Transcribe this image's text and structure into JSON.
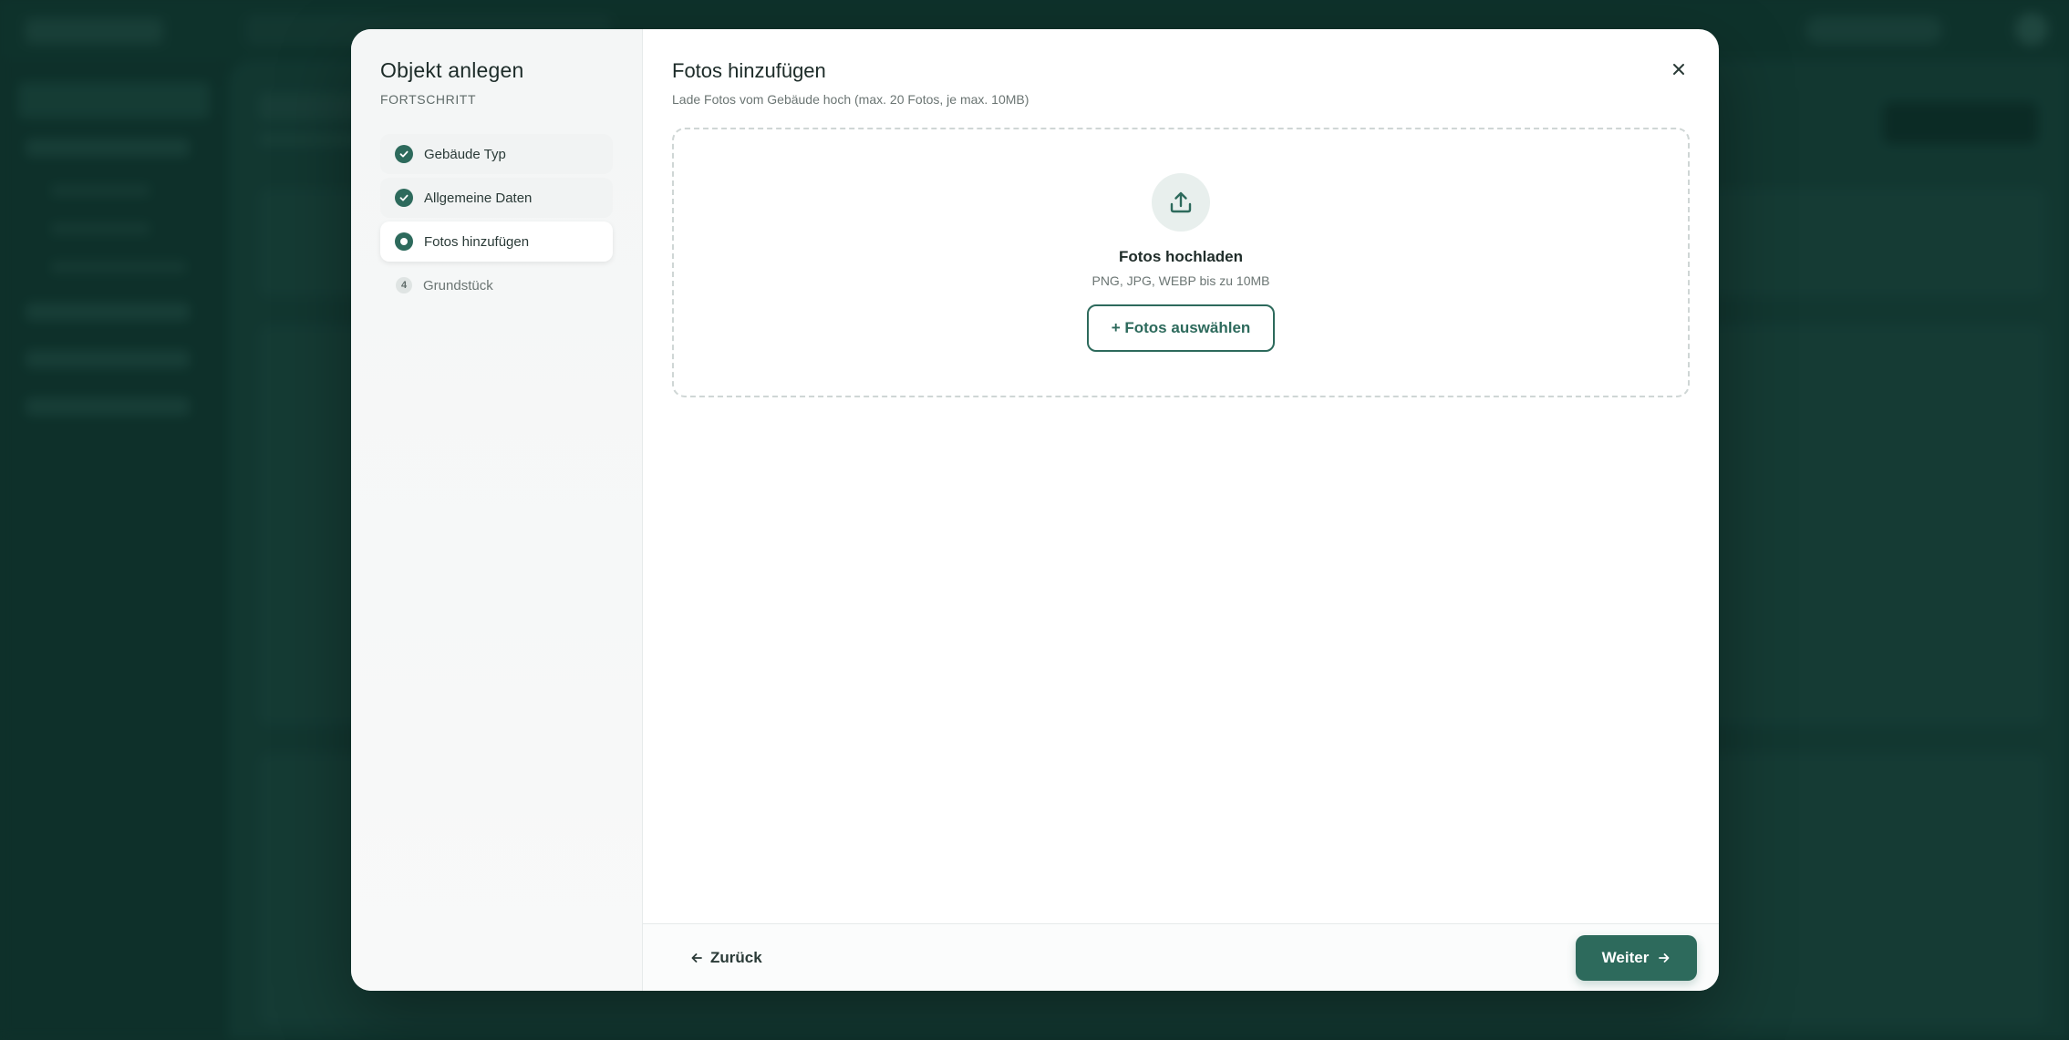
{
  "modal": {
    "title": "Objekt anlegen",
    "progress_label": "FORTSCHRITT",
    "steps": [
      {
        "label": "Gebäude Typ",
        "status": "done"
      },
      {
        "label": "Allgemeine Daten",
        "status": "done"
      },
      {
        "label": "Fotos hinzufügen",
        "status": "active"
      },
      {
        "label": "Grundstück",
        "status": "pending",
        "number": "4"
      }
    ],
    "content": {
      "title": "Fotos hinzufügen",
      "description": "Lade Fotos vom Gebäude hoch (max. 20 Fotos, je max. 10MB)",
      "upload": {
        "icon": "upload-icon",
        "title": "Fotos hochladen",
        "hint": "PNG, JPG, WEBP bis zu 10MB",
        "button_label": "+ Fotos auswählen"
      }
    },
    "footer": {
      "back_label": "Zurück",
      "next_label": "Weiter"
    }
  },
  "colors": {
    "accent": "#2d6a5c",
    "background": "#143a33"
  }
}
